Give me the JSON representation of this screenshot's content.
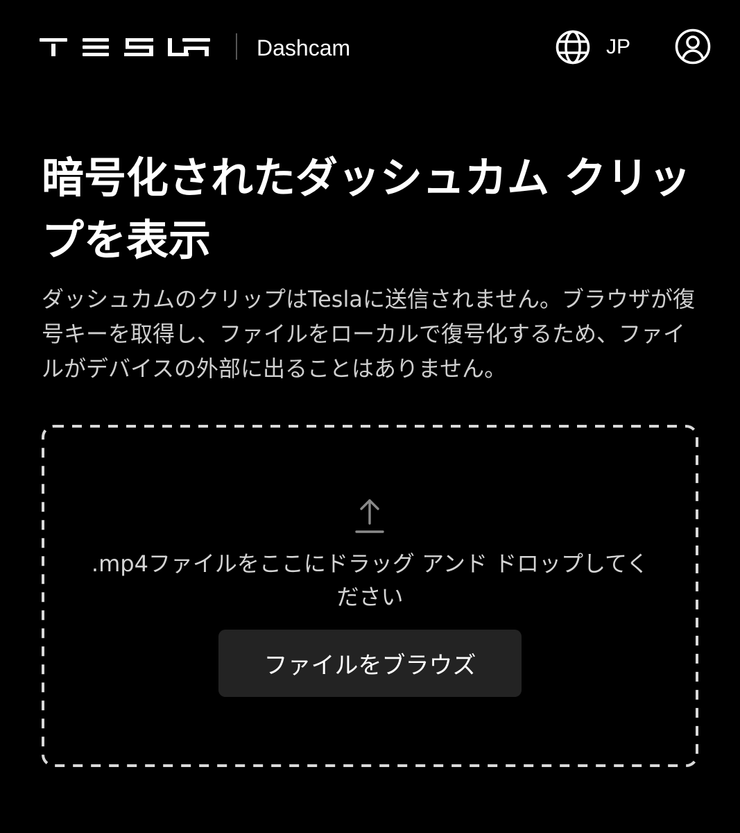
{
  "header": {
    "logo_text": "TESLA",
    "app_name": "Dashcam",
    "language_code": "JP",
    "language_icon": "globe-icon",
    "account_icon": "user-circle-icon"
  },
  "main": {
    "title": "暗号化されたダッシュカム クリップを表示",
    "description": "ダッシュカムのクリップはTeslaに送信されません。ブラウザが復号キーを取得し、ファイルをローカルで復号化するため、ファイルがデバイスの外部に出ることはありません。",
    "dropzone": {
      "icon": "upload-arrow-icon",
      "instruction": ".mp4ファイルをここにドラッグ アンド ドロップしてください",
      "browse_label": "ファイルをブラウズ"
    }
  },
  "colors": {
    "background": "#000000",
    "text_primary": "#ffffff",
    "text_secondary": "#cfcfcf",
    "button_background": "#232323",
    "dropzone_border": "#d9d9d9",
    "icon_muted": "#8a8a8a"
  }
}
